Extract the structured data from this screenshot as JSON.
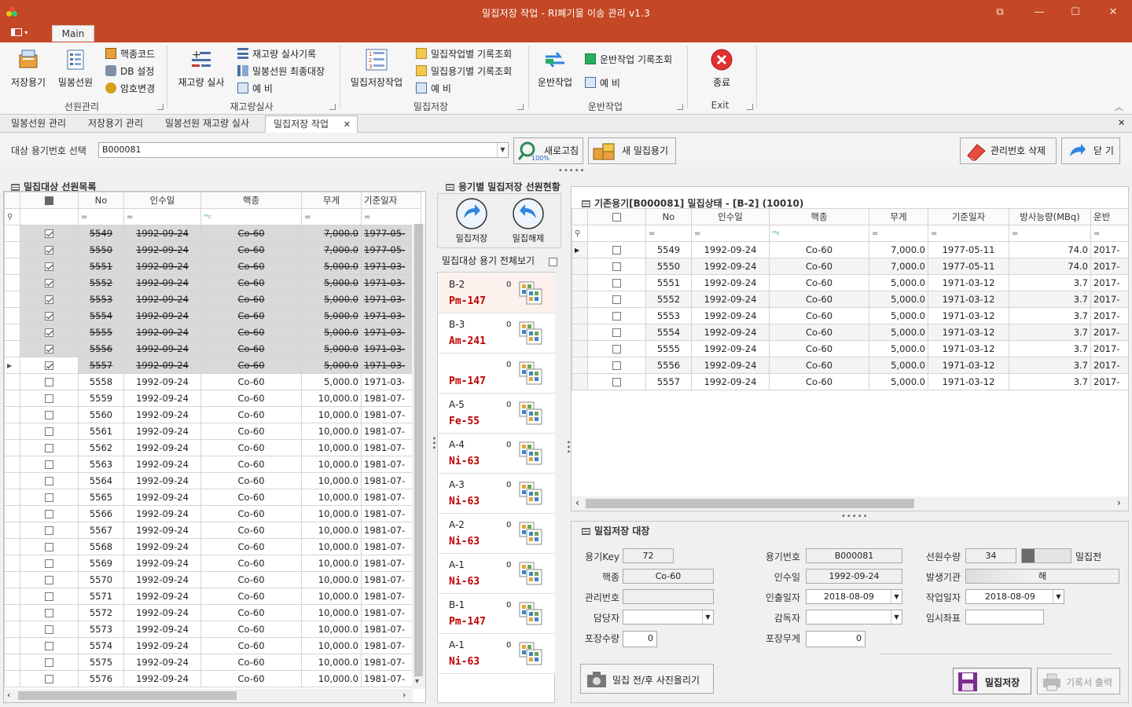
{
  "window": {
    "title": "밀집저장 작업 - RI폐기물 이송 관리 v1.3",
    "controls": [
      "⧉",
      "—",
      "☐",
      "✕"
    ]
  },
  "menu": {
    "file_icon": "menu-icon",
    "tab": "Main"
  },
  "ribbon": {
    "groups": [
      {
        "label": "선원관리",
        "big": [
          {
            "label": "저장용기",
            "icon": "container-icon"
          },
          {
            "label": "밀봉선원",
            "icon": "sealed-source-icon"
          }
        ],
        "small": [
          {
            "label": "핵종코드",
            "icon": "nuclide-icon"
          },
          {
            "label": "DB 설정",
            "icon": "database-icon"
          },
          {
            "label": "암호변경",
            "icon": "password-icon"
          }
        ]
      },
      {
        "label": "재고량실사",
        "big": [
          {
            "label": "재고량 실사",
            "icon": "inventory-icon"
          }
        ],
        "small": [
          {
            "label": "재고량 실사기록",
            "icon": "record-icon"
          },
          {
            "label": "밀봉선원 최종대장",
            "icon": "ledger-icon"
          },
          {
            "label": "예 비",
            "icon": "spare-icon"
          }
        ]
      },
      {
        "label": "밀집저장",
        "big": [
          {
            "label": "밀집저장작업",
            "icon": "dense-storage-icon"
          }
        ],
        "small": [
          {
            "label": "밀집작업별 기록조회",
            "icon": "query-icon"
          },
          {
            "label": "밀집용기별 기록조회",
            "icon": "query-icon"
          },
          {
            "label": "예 비",
            "icon": "spare-icon"
          }
        ]
      },
      {
        "label": "운반작업",
        "big": [
          {
            "label": "운반작업",
            "icon": "transport-icon"
          }
        ],
        "small": [
          {
            "label": "운반작업 기록조회",
            "icon": "query-icon"
          },
          {
            "label": "예 비",
            "icon": "spare-icon"
          }
        ]
      },
      {
        "label": "Exit",
        "big": [
          {
            "label": "종료",
            "icon": "exit-icon"
          }
        ],
        "small": []
      }
    ]
  },
  "doc_tabs": [
    "밀봉선원 관리",
    "저장용기 관리",
    "밀봉선원 재고량 실사",
    "밀집저장 작업"
  ],
  "toolbar": {
    "target_label": "대상 용기번호 선택",
    "target_value": "B000081",
    "refresh": "새로고침",
    "refresh_zoom": "100%",
    "new_container": "새 밀집용기",
    "delete_mgmt": "관리번호 삭제",
    "close": "닫 기"
  },
  "left_panel": {
    "title": "밀집대상 선원목록",
    "columns": [
      "No",
      "인수일",
      "핵종",
      "무게",
      "기준일자"
    ],
    "rows": [
      [
        "5549",
        "1992-09-24",
        "Co-60",
        "7,000.0",
        "1977-05-"
      ],
      [
        "5550",
        "1992-09-24",
        "Co-60",
        "7,000.0",
        "1977-05-"
      ],
      [
        "5551",
        "1992-09-24",
        "Co-60",
        "5,000.0",
        "1971-03-"
      ],
      [
        "5552",
        "1992-09-24",
        "Co-60",
        "5,000.0",
        "1971-03-"
      ],
      [
        "5553",
        "1992-09-24",
        "Co-60",
        "5,000.0",
        "1971-03-"
      ],
      [
        "5554",
        "1992-09-24",
        "Co-60",
        "5,000.0",
        "1971-03-"
      ],
      [
        "5555",
        "1992-09-24",
        "Co-60",
        "5,000.0",
        "1971-03-"
      ],
      [
        "5556",
        "1992-09-24",
        "Co-60",
        "5,000.0",
        "1971-03-"
      ],
      [
        "5557",
        "1992-09-24",
        "Co-60",
        "5,000.0",
        "1971-03-"
      ],
      [
        "5558",
        "1992-09-24",
        "Co-60",
        "5,000.0",
        "1971-03-"
      ],
      [
        "5559",
        "1992-09-24",
        "Co-60",
        "10,000.0",
        "1981-07-"
      ],
      [
        "5560",
        "1992-09-24",
        "Co-60",
        "10,000.0",
        "1981-07-"
      ],
      [
        "5561",
        "1992-09-24",
        "Co-60",
        "10,000.0",
        "1981-07-"
      ],
      [
        "5562",
        "1992-09-24",
        "Co-60",
        "10,000.0",
        "1981-07-"
      ],
      [
        "5563",
        "1992-09-24",
        "Co-60",
        "10,000.0",
        "1981-07-"
      ],
      [
        "5564",
        "1992-09-24",
        "Co-60",
        "10,000.0",
        "1981-07-"
      ],
      [
        "5565",
        "1992-09-24",
        "Co-60",
        "10,000.0",
        "1981-07-"
      ],
      [
        "5566",
        "1992-09-24",
        "Co-60",
        "10,000.0",
        "1981-07-"
      ],
      [
        "5567",
        "1992-09-24",
        "Co-60",
        "10,000.0",
        "1981-07-"
      ],
      [
        "5568",
        "1992-09-24",
        "Co-60",
        "10,000.0",
        "1981-07-"
      ],
      [
        "5569",
        "1992-09-24",
        "Co-60",
        "10,000.0",
        "1981-07-"
      ],
      [
        "5570",
        "1992-09-24",
        "Co-60",
        "10,000.0",
        "1981-07-"
      ],
      [
        "5571",
        "1992-09-24",
        "Co-60",
        "10,000.0",
        "1981-07-"
      ],
      [
        "5572",
        "1992-09-24",
        "Co-60",
        "10,000.0",
        "1981-07-"
      ],
      [
        "5573",
        "1992-09-24",
        "Co-60",
        "10,000.0",
        "1981-07-"
      ],
      [
        "5574",
        "1992-09-24",
        "Co-60",
        "10,000.0",
        "1981-07-"
      ],
      [
        "5575",
        "1992-09-24",
        "Co-60",
        "10,000.0",
        "1981-07-"
      ],
      [
        "5576",
        "1992-09-24",
        "Co-60",
        "10,000.0",
        "1981-07-"
      ]
    ],
    "checked_count": 9
  },
  "middle_panel": {
    "title": "용기별 밀집저장 선원현황",
    "store_btn": "밀집저장",
    "release_btn": "밀집해제",
    "show_all_label": "밀집대상 용기 전체보기",
    "cards": [
      {
        "code": "B-2",
        "nuclide": "Pm-147",
        "count": "0"
      },
      {
        "code": "B-3",
        "nuclide": "Am-241",
        "count": "0"
      },
      {
        "code": "",
        "nuclide": "Pm-147",
        "count": "0"
      },
      {
        "code": "A-5",
        "nuclide": "Fe-55",
        "count": "0"
      },
      {
        "code": "A-4",
        "nuclide": "Ni-63",
        "count": "0"
      },
      {
        "code": "A-3",
        "nuclide": "Ni-63",
        "count": "0"
      },
      {
        "code": "A-2",
        "nuclide": "Ni-63",
        "count": "0"
      },
      {
        "code": "A-1",
        "nuclide": "Ni-63",
        "count": "0"
      },
      {
        "code": "B-1",
        "nuclide": "Pm-147",
        "count": "0"
      },
      {
        "code": "A-1",
        "nuclide": "Ni-63",
        "count": "0"
      }
    ]
  },
  "right_panel": {
    "title": "기존용기[B000081] 밀집상태  -  [B-2] (10010)",
    "columns": [
      "No",
      "인수일",
      "핵종",
      "무게",
      "기준일자",
      "방사능량(MBq)",
      "운반"
    ],
    "rows": [
      [
        "5549",
        "1992-09-24",
        "Co-60",
        "7,000.0",
        "1977-05-11",
        "74.0",
        "2017-"
      ],
      [
        "5550",
        "1992-09-24",
        "Co-60",
        "7,000.0",
        "1977-05-11",
        "74.0",
        "2017-"
      ],
      [
        "5551",
        "1992-09-24",
        "Co-60",
        "5,000.0",
        "1971-03-12",
        "3.7",
        "2017-"
      ],
      [
        "5552",
        "1992-09-24",
        "Co-60",
        "5,000.0",
        "1971-03-12",
        "3.7",
        "2017-"
      ],
      [
        "5553",
        "1992-09-24",
        "Co-60",
        "5,000.0",
        "1971-03-12",
        "3.7",
        "2017-"
      ],
      [
        "5554",
        "1992-09-24",
        "Co-60",
        "5,000.0",
        "1971-03-12",
        "3.7",
        "2017-"
      ],
      [
        "5555",
        "1992-09-24",
        "Co-60",
        "5,000.0",
        "1971-03-12",
        "3.7",
        "2017-"
      ],
      [
        "5556",
        "1992-09-24",
        "Co-60",
        "5,000.0",
        "1971-03-12",
        "3.7",
        "2017-"
      ],
      [
        "5557",
        "1992-09-24",
        "Co-60",
        "5,000.0",
        "1971-03-12",
        "3.7",
        "2017-"
      ]
    ]
  },
  "ledger": {
    "title": "밀집저장 대장",
    "key_label": "용기Key",
    "key_value": "72",
    "nuclide_label": "핵종",
    "nuclide_value": "Co-60",
    "mgmt_label": "관리번호",
    "mgmt_value": "",
    "manager_label": "담당자",
    "manager_value": "",
    "pack_qty_label": "포장수량",
    "pack_qty_value": "0",
    "container_label": "용기번호",
    "container_value": "B000081",
    "recv_label": "인수일",
    "recv_value": "1992-09-24",
    "out_label": "인출일자",
    "out_value": "2018-08-09",
    "supervisor_label": "감독자",
    "supervisor_value": "",
    "pack_wt_label": "포장무게",
    "pack_wt_value": "0",
    "src_qty_label": "선원수량",
    "src_qty_value": "34",
    "status_value": "밀집전",
    "origin_label": "발생기관",
    "origin_value": "해",
    "work_label": "작업일자",
    "work_value": "2018-08-09",
    "temp_label": "임시좌표",
    "temp_value": "",
    "photo_btn": "밀집 전/후 사진올리기",
    "save_btn": "밀집저장",
    "print_btn": "기록서 출력"
  },
  "colors": {
    "title_bar": "#c44825",
    "nuclide_red": "#c00000"
  }
}
